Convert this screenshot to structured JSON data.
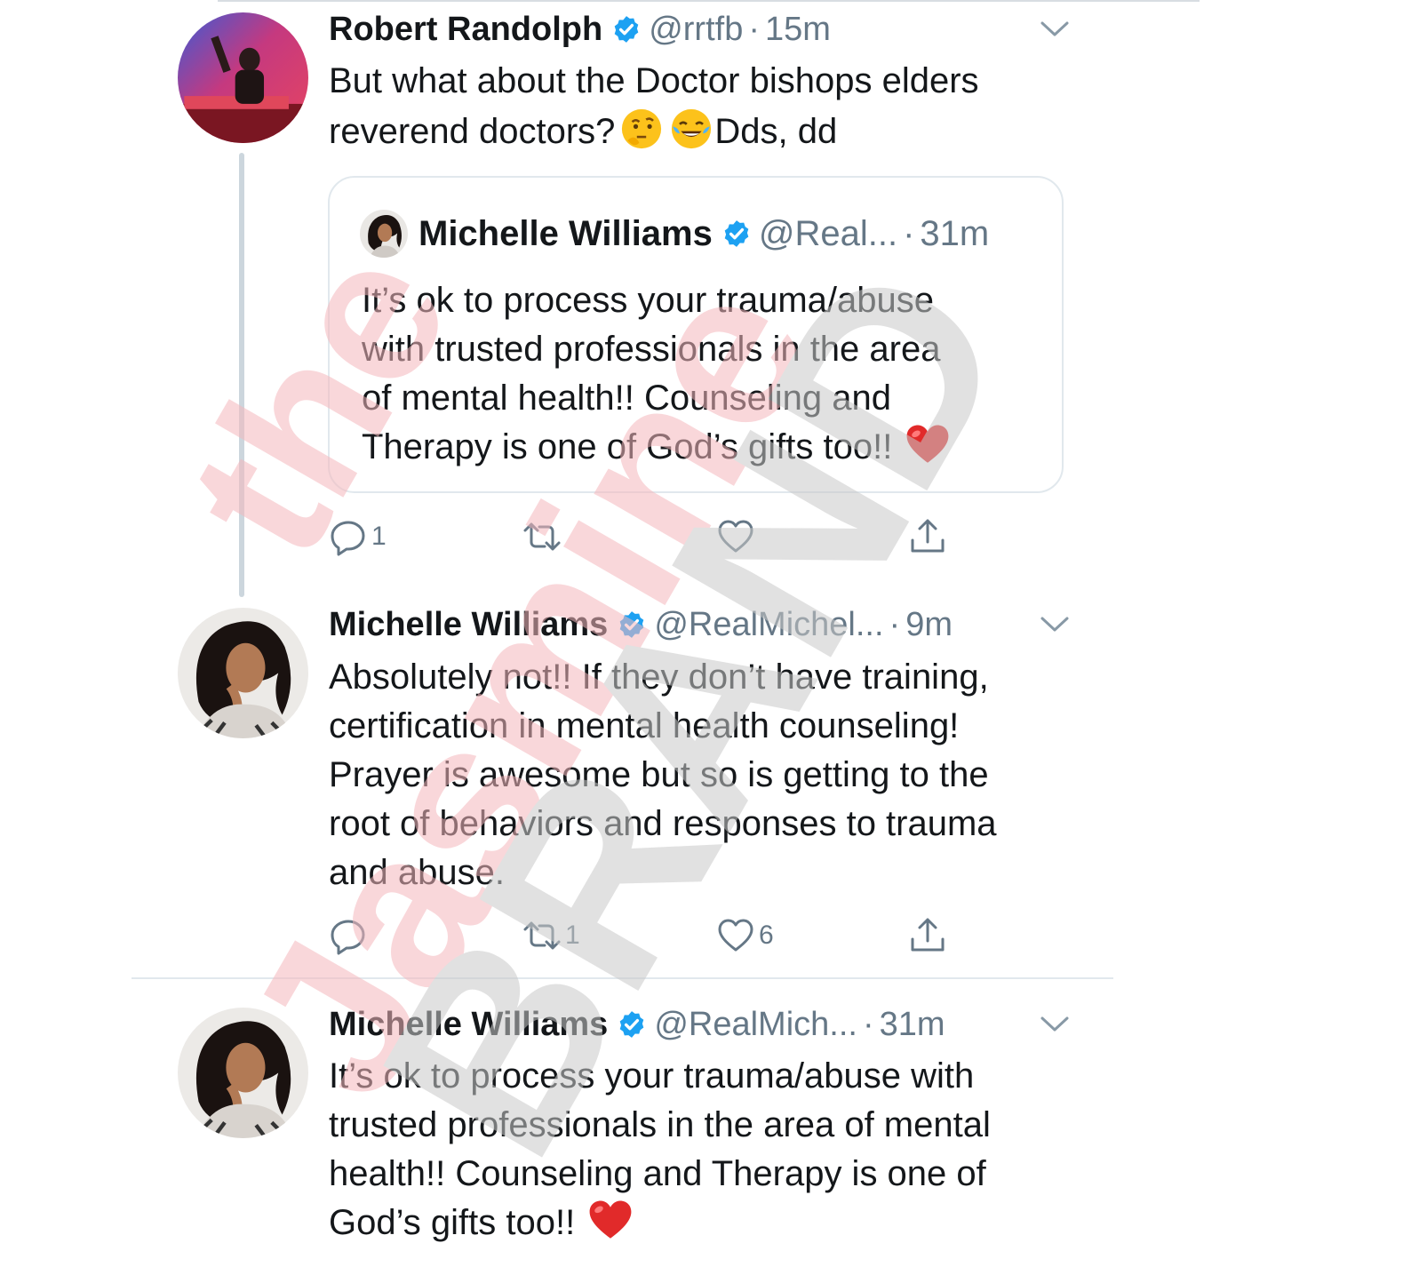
{
  "tweets": [
    {
      "name": "Robert Randolph",
      "handle": "@rrtfb",
      "time": "15m",
      "lines": [
        "But what about the Doctor bishops elders",
        "reverend doctors?"
      ],
      "line2_suffix": "Dds, dd",
      "emojis": [
        "thinking-face",
        "tears-of-joy"
      ],
      "quote": {
        "name": "Michelle Williams",
        "handle": "@Real...",
        "time": "31m",
        "lines": [
          "It’s ok to process your trauma/abuse",
          "with trusted professionals in the area",
          "of mental health!! Counseling and",
          "Therapy is one of God’s gifts too!!"
        ],
        "emoji": "red-heart"
      },
      "actions": {
        "reply_count": "1",
        "retweet_count": "",
        "like_count": ""
      }
    },
    {
      "name": "Michelle Williams",
      "handle": "@RealMichel...",
      "time": "9m",
      "lines": [
        "Absolutely not!! If they don’t have training,",
        "certification in mental health counseling!",
        "Prayer is awesome but so is getting to the",
        "root of behaviors and responses to trauma",
        "and abuse."
      ],
      "actions": {
        "reply_count": "",
        "retweet_count": "1",
        "like_count": "6"
      }
    },
    {
      "name": "Michelle Williams",
      "handle": "@RealMich...",
      "time": "31m",
      "lines": [
        "It’s ok to process your trauma/abuse with",
        "trusted professionals in the area of mental",
        "health!! Counseling and Therapy is one of",
        "God’s gifts too!!"
      ],
      "emoji": "red-heart"
    }
  ],
  "separator": "·",
  "watermark": {
    "line1": "the",
    "line2": "Jasmine",
    "line3": "BRAND"
  },
  "colors": {
    "verified": "#1da1f2",
    "muted": "#657786",
    "text": "#14171a",
    "heart": "#e0245e",
    "watermark_red": "#f5b8bd",
    "watermark_gray": "#d3d3d3"
  }
}
